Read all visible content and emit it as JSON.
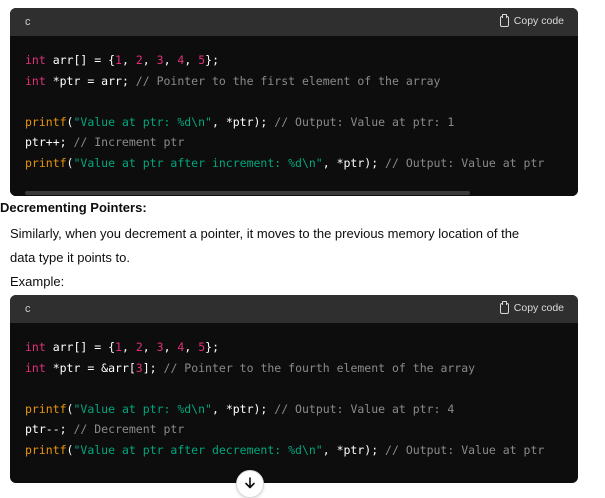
{
  "block1": {
    "lang": "c",
    "copy_label": "Copy code",
    "lines": [
      [
        [
          "ty",
          "int"
        ],
        [
          "p",
          " arr[] = {"
        ],
        [
          "num",
          "1"
        ],
        [
          "p",
          ", "
        ],
        [
          "num",
          "2"
        ],
        [
          "p",
          ", "
        ],
        [
          "num",
          "3"
        ],
        [
          "p",
          ", "
        ],
        [
          "num",
          "4"
        ],
        [
          "p",
          ", "
        ],
        [
          "num",
          "5"
        ],
        [
          "p",
          "};"
        ]
      ],
      [
        [
          "ty",
          "int"
        ],
        [
          "p",
          " *ptr = arr; "
        ],
        [
          "cm",
          "// Pointer to the first element of the array"
        ]
      ],
      [],
      [
        [
          "kw",
          "printf"
        ],
        [
          "p",
          "("
        ],
        [
          "str",
          "\"Value at ptr: %d\\n\""
        ],
        [
          "p",
          ", *ptr); "
        ],
        [
          "cm",
          "// Output: Value at ptr: 1"
        ]
      ],
      [
        [
          "p",
          "ptr++; "
        ],
        [
          "cm",
          "// Increment ptr"
        ]
      ],
      [
        [
          "kw",
          "printf"
        ],
        [
          "p",
          "("
        ],
        [
          "str",
          "\"Value at ptr after increment: %d\\n\""
        ],
        [
          "p",
          ", *ptr); "
        ],
        [
          "cm",
          "// Output: Value at ptr"
        ]
      ]
    ]
  },
  "heading": "Decrementing Pointers:",
  "paragraph": {
    "line1": "Similarly, when you decrement a pointer, it moves to the previous memory location of the",
    "line2": "data type it points to.",
    "example": "Example:"
  },
  "block2": {
    "lang": "c",
    "copy_label": "Copy code",
    "lines": [
      [
        [
          "ty",
          "int"
        ],
        [
          "p",
          " arr[] = {"
        ],
        [
          "num",
          "1"
        ],
        [
          "p",
          ", "
        ],
        [
          "num",
          "2"
        ],
        [
          "p",
          ", "
        ],
        [
          "num",
          "3"
        ],
        [
          "p",
          ", "
        ],
        [
          "num",
          "4"
        ],
        [
          "p",
          ", "
        ],
        [
          "num",
          "5"
        ],
        [
          "p",
          "};"
        ]
      ],
      [
        [
          "ty",
          "int"
        ],
        [
          "p",
          " *ptr = &arr["
        ],
        [
          "num",
          "3"
        ],
        [
          "p",
          "]; "
        ],
        [
          "cm",
          "// Pointer to the fourth element of the array"
        ]
      ],
      [],
      [
        [
          "kw",
          "printf"
        ],
        [
          "p",
          "("
        ],
        [
          "str",
          "\"Value at ptr: %d\\n\""
        ],
        [
          "p",
          ", *ptr); "
        ],
        [
          "cm",
          "// Output: Value at ptr: 4"
        ]
      ],
      [
        [
          "p",
          "ptr--; "
        ],
        [
          "cm",
          "// Decrement ptr"
        ]
      ],
      [
        [
          "kw",
          "printf"
        ],
        [
          "p",
          "("
        ],
        [
          "str",
          "\"Value at ptr after decrement: %d\\n\""
        ],
        [
          "p",
          ", *ptr); "
        ],
        [
          "cm",
          "// Output: Value at ptr"
        ]
      ]
    ]
  },
  "icons": {
    "copy": "clipboard-icon",
    "scroll": "arrow-down-icon"
  },
  "colors": {
    "code_bg": "#0d0d0d",
    "header_bg": "#2f2f2f",
    "keyword": "#e9950c",
    "type": "#df3079",
    "string": "#00a67d",
    "comment": "#8a8a8a"
  }
}
